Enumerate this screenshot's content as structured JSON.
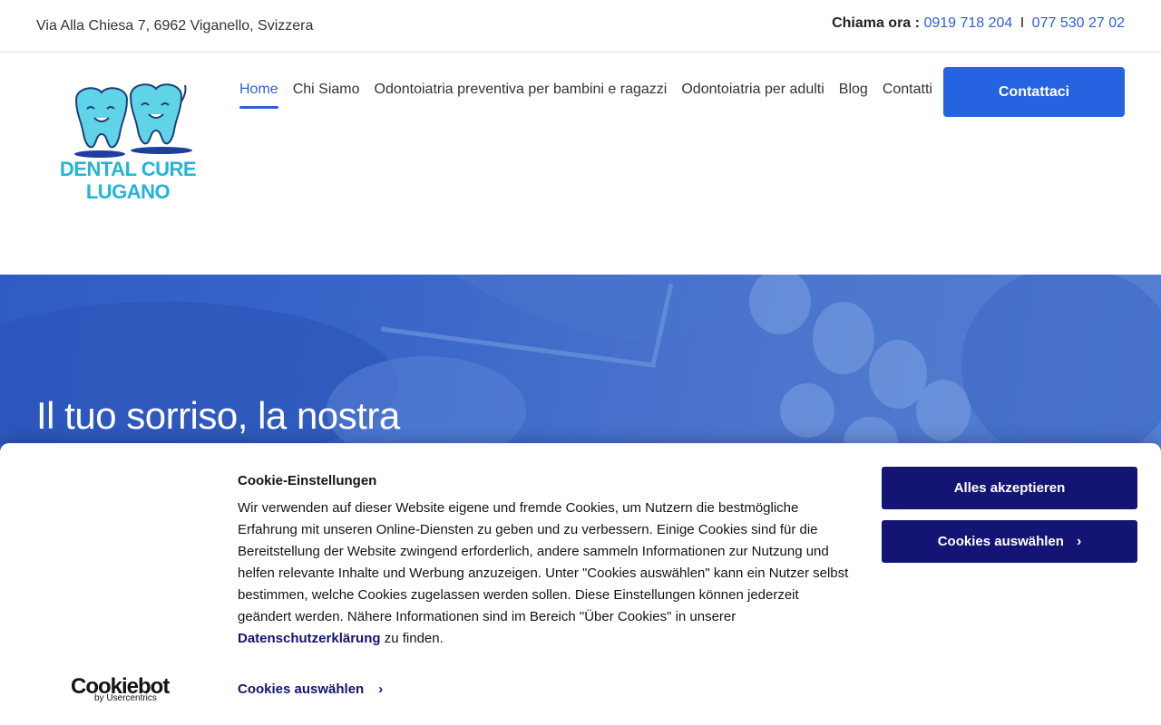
{
  "topbar": {
    "address": "Via Alla Chiesa 7, 6962 Viganello, Svizzera",
    "phone_label": "Chiama ora :",
    "phone1": "0919 718 204",
    "separator": "I",
    "phone2": "077 530 27 02"
  },
  "logo": {
    "line1": "DENTAL CURE",
    "line2": "LUGANO"
  },
  "nav": {
    "items": [
      {
        "label": "Home",
        "active": true
      },
      {
        "label": "Chi Siamo"
      },
      {
        "label": "Odontoiatria preventiva per bambini e ragazzi"
      },
      {
        "label": "Odontoiatria per adulti"
      },
      {
        "label": "Blog"
      },
      {
        "label": "Contatti"
      }
    ],
    "cta_label": "Contattaci"
  },
  "hero": {
    "title": "Il tuo sorriso, la nostra"
  },
  "cookie": {
    "title": "Cookie-Einstellungen",
    "text_main": "Wir verwenden auf dieser Website eigene und fremde Cookies, um Nutzern die bestmögliche Erfahrung mit unseren Online-Diensten zu geben und zu verbessern. Einige Cookies sind für die Bereitstellung der Website zwingend erforderlich, andere sammeln Informationen zur Nutzung und helfen relevante Inhalte und Werbung anzuzeigen. Unter \"Cookies auswählen\" kann ein Nutzer selbst bestimmen, welche Cookies zugelassen werden sollen. Diese Einstellungen können jederzeit geändert werden. Nähere Informationen sind im Bereich \"Über Cookies\" in unserer",
    "privacy_link": "Datenschutzerklärung",
    "text_end": "zu finden.",
    "accept_label": "Alles akzeptieren",
    "select_label": "Cookies auswählen",
    "select_link_label": "Cookies auswählen",
    "brand_name": "Cookiebot",
    "brand_sub": "by Usercentrics"
  },
  "colors": {
    "accent": "#2f5fd1",
    "cta": "#2563e1",
    "cookie_button": "#141475",
    "logo_teal": "#22b5d6"
  }
}
